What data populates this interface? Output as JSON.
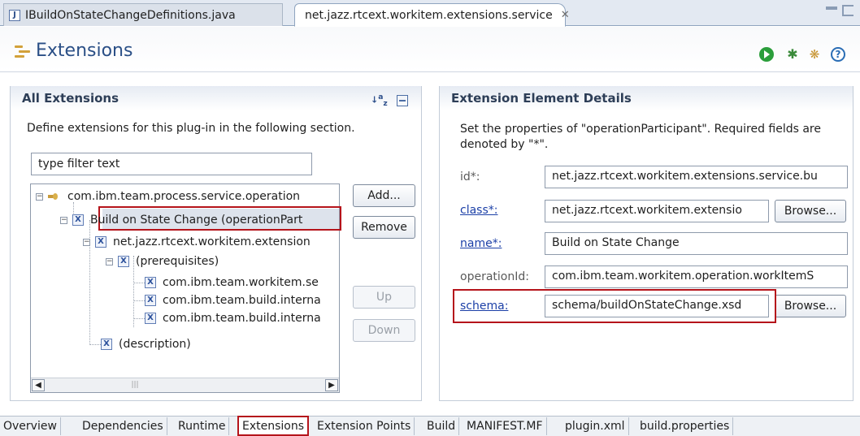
{
  "editor_tabs": [
    {
      "label": "IBuildOnStateChangeDefinitions.java"
    },
    {
      "label": "net.jazz.rtcext.workitem.extensions.service"
    }
  ],
  "header": {
    "title": "Extensions"
  },
  "all_extensions": {
    "title": "All Extensions",
    "description": "Define extensions for this plug-in in the following section.",
    "filter_value": "type filter text",
    "buttons": {
      "add": "Add...",
      "remove": "Remove",
      "up": "Up",
      "down": "Down"
    },
    "tree": [
      {
        "label": "com.ibm.team.process.service.operation"
      },
      {
        "label": "Build on State Change (operationPart"
      },
      {
        "label": "net.jazz.rtcext.workitem.extension"
      },
      {
        "label": "(prerequisites)"
      },
      {
        "label": "com.ibm.team.workitem.se"
      },
      {
        "label": "com.ibm.team.build.interna"
      },
      {
        "label": "com.ibm.team.build.interna"
      },
      {
        "label": "(description)"
      }
    ]
  },
  "details": {
    "title": "Extension Element Details",
    "description": "Set the properties of \"operationParticipant\". Required fields are denoted by \"*\".",
    "fields": {
      "id": {
        "label": "id*:",
        "value": "net.jazz.rtcext.workitem.extensions.service.bu"
      },
      "class": {
        "label": "class*:",
        "value": "net.jazz.rtcext.workitem.extensio"
      },
      "name": {
        "label": "name*:",
        "value": "Build on State Change"
      },
      "operationId": {
        "label": "operationId:",
        "value": "com.ibm.team.workitem.operation.workItemS"
      },
      "schema": {
        "label": "schema:",
        "value": "schema/buildOnStateChange.xsd"
      }
    },
    "browse_label": "Browse..."
  },
  "bottom_tabs": [
    {
      "label": "Overview"
    },
    {
      "label": "Dependencies"
    },
    {
      "label": "Runtime"
    },
    {
      "label": "Extensions"
    },
    {
      "label": "Extension Points"
    },
    {
      "label": "Build"
    },
    {
      "label": "MANIFEST.MF"
    },
    {
      "label": "plugin.xml"
    },
    {
      "label": "build.properties"
    }
  ],
  "colors": {
    "highlight_border": "#b5141b",
    "link": "#1b3fa7",
    "title": "#2a4f86"
  }
}
